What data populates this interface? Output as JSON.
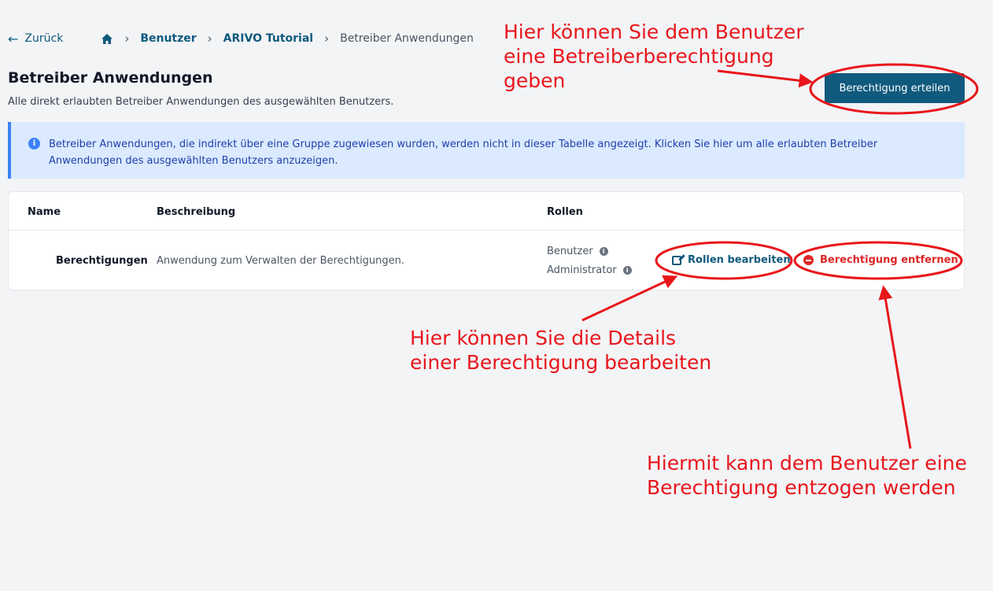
{
  "breadcrumb": {
    "back_label": "Zurück",
    "items": [
      "Benutzer",
      "ARIVO Tutorial"
    ],
    "current": "Betreiber Anwendungen"
  },
  "header": {
    "title": "Betreiber Anwendungen",
    "subtitle": "Alle direkt erlaubten Betreiber Anwendungen des ausgewählten Benutzers.",
    "primary_button": "Berechtigung erteilen"
  },
  "info": {
    "text": "Betreiber Anwendungen, die indirekt über eine Gruppe zugewiesen wurden, werden nicht in dieser Tabelle angezeigt. Klicken Sie hier um alle erlaubten Betreiber Anwendungen des ausgewählten Benutzers anzuzeigen."
  },
  "table": {
    "columns": [
      "Name",
      "Beschreibung",
      "Rollen"
    ],
    "rows": [
      {
        "name": "Berechtigungen",
        "description": "Anwendung zum Verwalten der Berechtigungen.",
        "roles": [
          "Benutzer",
          "Administrator"
        ],
        "edit_label": "Rollen bearbeiten",
        "remove_label": "Berechtigung entfernen"
      }
    ]
  },
  "annotations": {
    "grant": [
      "Hier können Sie dem Benutzer",
      "eine Betreiberberechtigung",
      "geben"
    ],
    "edit": [
      "Hier können Sie die Details",
      "einer Berechtigung bearbeiten"
    ],
    "remove": [
      "Hiermit kann dem Benutzer eine",
      "Berechtigung entzogen werden"
    ]
  },
  "colors": {
    "primary": "#105a7e",
    "danger": "#dc2626",
    "info_bg": "#dbeafe",
    "annotation": "#e8161b"
  }
}
